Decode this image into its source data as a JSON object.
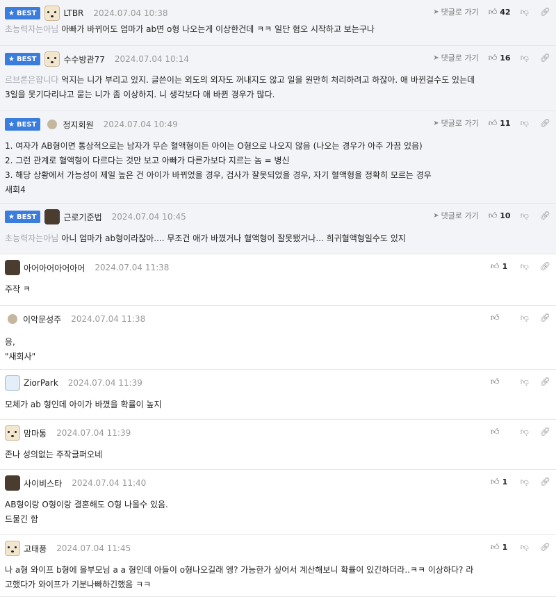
{
  "comments": [
    {
      "best": true,
      "nick": "LTBR",
      "date": "2024.07.04 10:38",
      "reply": "댓글로 가기",
      "up": "42",
      "target": "초능력자는아님",
      "lines": [
        "아빠가 바뀌어도 엄마가 ab면 o형 나오는게 이상한건데 ㅋㅋ 일단 혐오 시작하고 보는구나"
      ]
    },
    {
      "best": true,
      "nick": "수수방관77",
      "date": "2024.07.04 10:14",
      "reply": "댓글로 가기",
      "up": "16",
      "target": "르브론은합니다",
      "lines": [
        "억지는 니가 부리고 있지. 글쓴이는 외도의 외자도 꺼내지도 않고 일을 원만히 처리하려고 하잖아. 애 바뀐걸수도 있는데",
        "3일을 못기다리냐고 묻는 니가 좀 이상하지. 니 생각보다 애 바뀐 경우가 많다."
      ]
    },
    {
      "best": true,
      "nick": "정지회원",
      "date": "2024.07.04 10:49",
      "reply": "댓글로 가기",
      "up": "11",
      "target": "",
      "lines": [
        "1. 여자가 AB형이면 통상적으로는 남자가 무슨 혈액형이든 아이는 O형으로 나오지 않음 (나오는 경우가 아주 가끔 있음)",
        "2. 그런 관계로 혈액형이 다르다는 것만 보고 아빠가 다른가보다 지르는 놈 = 병신",
        "3. 해당 상황에서 가능성이 제일 높은 건 아이가 바뀌었을 경우, 검사가 잘못되었을 경우, 자기 혈액형을 정확히 모르는 경우",
        "새회4"
      ]
    },
    {
      "best": true,
      "nick": "근로기준법",
      "date": "2024.07.04 10:45",
      "reply": "댓글로 가기",
      "up": "10",
      "target": "초능력자는아님",
      "lines": [
        "아니 엄마가 ab형이라잖아.... 무조건 애가 바꼈거나 혈액형이 잘못됐거나... 희귀혈액형일수도 있지"
      ]
    },
    {
      "best": false,
      "nick": "아어아어아어아어",
      "date": "2024.07.04 11:38",
      "reply": "",
      "up": "1",
      "target": "",
      "lines": [
        "주작 ㅋ"
      ]
    },
    {
      "best": false,
      "nick": "이악문성주",
      "date": "2024.07.04 11:38",
      "reply": "",
      "up": "",
      "target": "",
      "lines": [
        "응,",
        "\"새회사\""
      ]
    },
    {
      "best": false,
      "nick": "ZiorPark",
      "date": "2024.07.04 11:39",
      "reply": "",
      "up": "",
      "target": "",
      "lines": [
        "모체가 ab 형인데 아이가 바꼈을 확률이 높지"
      ]
    },
    {
      "best": false,
      "nick": "맘마통",
      "date": "2024.07.04 11:39",
      "reply": "",
      "up": "",
      "target": "",
      "lines": [
        "존나 성의없는 주작글퍼오네"
      ]
    },
    {
      "best": false,
      "nick": "사이비스타",
      "date": "2024.07.04 11:40",
      "reply": "",
      "up": "1",
      "target": "",
      "lines": [
        "AB형이랑 O형이랑 결혼해도 O형 나올수 있음.",
        "드물긴 함"
      ]
    },
    {
      "best": false,
      "nick": "고태풍",
      "date": "2024.07.04 11:45",
      "reply": "",
      "up": "1",
      "target": "",
      "lines": [
        "나 a형 와이프 b형에 올부모님 a a 형인데 아들이 o형나오길래 엥? 가능한가 싶어서 계산해보니 확률이 있긴하더라..ㅋㅋ 이상하다? 라",
        "고했다가 와이프가 기분나빠하긴했음 ㅋㅋ"
      ]
    }
  ],
  "best_label": "BEST",
  "icons": {
    "best_star": "star-icon",
    "reply": "arrow-icon",
    "up": "thumb-up-icon",
    "down": "thumb-down-icon",
    "link": "link-icon"
  }
}
